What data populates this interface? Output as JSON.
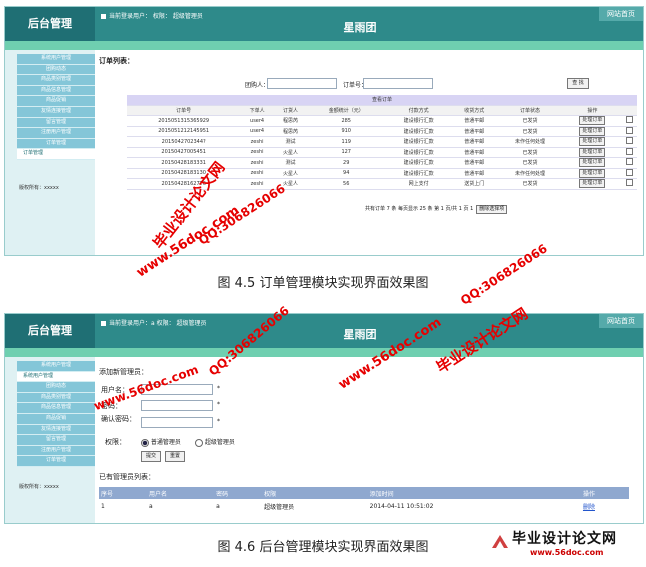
{
  "screen1": {
    "brand": "后台管理",
    "user_info": "当前登录用户： 权限： 超级管理员",
    "site_button": "网站首页",
    "app_title": "星雨团",
    "menu": [
      "系统用户管理",
      "团购动态",
      "商品类别管理",
      "商品信息管理",
      "商品促销",
      "友情连接管理",
      "留言管理",
      "注册用户管理",
      "订单管理",
      "订单管理"
    ],
    "active_menu_index": 9,
    "copyright": "版权所有：xxxxx",
    "section_title": "订单列表：",
    "filter": {
      "buyer_label": "团购人：",
      "order_label": "订单号：",
      "search_button": "查 找"
    },
    "table_title": "查看订单",
    "columns": [
      "订单号",
      "下单人",
      "订货人",
      "金额统计（元）",
      "付款方式",
      "收货方式",
      "订单状态",
      "操作"
    ],
    "rows": [
      [
        "2015051315365929",
        "user4",
        "程思芮",
        "285",
        "建设银行汇款",
        "普通平邮",
        "已发货",
        "处理订单"
      ],
      [
        "2015051212145951",
        "user4",
        "程思芮",
        "910",
        "建设银行汇款",
        "普通平邮",
        "已发货",
        "处理订单"
      ],
      [
        "2015042702344?",
        "zeshi",
        "测试",
        "119",
        "建设银行汇款",
        "普通平邮",
        "未作任何处理",
        "处理订单"
      ],
      [
        "20150427005451",
        "zeshi",
        "火星人",
        "127",
        "建设银行汇款",
        "普通平邮",
        "已发货",
        "处理订单"
      ],
      [
        "20150428183331",
        "zeshi",
        "测试",
        "29",
        "建设银行汇款",
        "普通平邮",
        "已发货",
        "处理订单"
      ],
      [
        "20150428183130",
        "zeshi",
        "火星人",
        "94",
        "建设银行汇款",
        "普通平邮",
        "未作任何处理",
        "处理订单"
      ],
      [
        "201504281627T6",
        "zeshi",
        "火星人",
        "56",
        "网上支付",
        "送货上门",
        "已发货",
        "处理订单"
      ]
    ],
    "pager_text": "共有订单 7 条 每页显示 25 条 第 1 页/共 1 页 1",
    "delete_selected": "删除选择项",
    "caption": "图 4.5  订单管理模块实现界面效果图"
  },
  "screen2": {
    "brand": "后台管理",
    "user_info": "当前登录用户：a  权限： 超级管理员",
    "site_button": "网站首页",
    "app_title": "星雨团",
    "menu": [
      "系统用户管理",
      "系统用户管理",
      "团购动态",
      "商品类别管理",
      "商品信息管理",
      "商品促销",
      "友情连接管理",
      "留言管理",
      "注册用户管理",
      "订单管理"
    ],
    "active_menu_index": 1,
    "copyright": "版权所有：xxxxx",
    "form_title": "添加新管理员：",
    "fields": {
      "username": "用户名：",
      "password": "密码：",
      "confirm": "确认密码：",
      "role": "权限：",
      "required": "*"
    },
    "roles": [
      "普通管理员",
      "超级管理员"
    ],
    "submit": "提交",
    "reset": "重置",
    "list_title": "已有管理员列表：",
    "columns": [
      "序号",
      "用户名",
      "密码",
      "权限",
      "添加时间",
      "操作"
    ],
    "rows": [
      [
        "1",
        "a",
        "a",
        "超级管理员",
        "2014-04-11 10:51:02",
        "删除"
      ]
    ],
    "caption": "图 4.6  后台管理模块实现界面效果图"
  },
  "watermarks": {
    "site": "www.56doc.com",
    "qq": "QQ:306826066",
    "brand": "毕业设计论文网"
  },
  "logo": {
    "title": "毕业设计论文网",
    "url": "www.56doc.com"
  },
  "colors": {
    "header": "#2e8a8a",
    "green_band": "#6fcfb0",
    "menu": "#84c6d8",
    "watermark": "#e60000"
  }
}
